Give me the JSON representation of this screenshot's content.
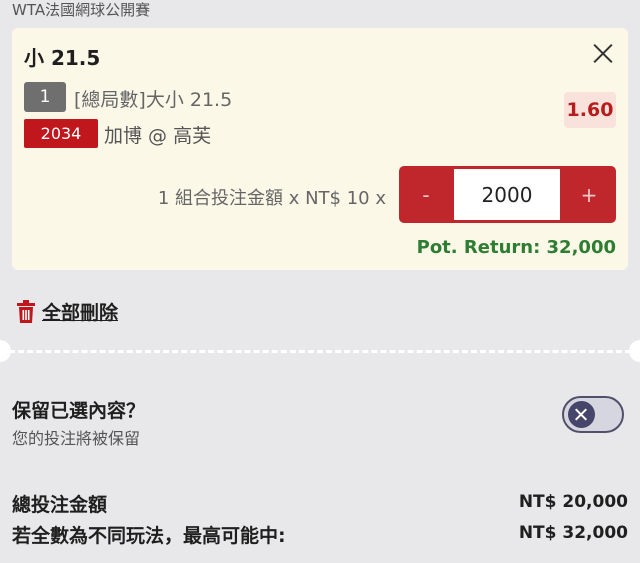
{
  "league": "WTA法國網球公開賽",
  "selection": {
    "title": "小 21.5",
    "leg_number": "1",
    "market": "[總局數]大小 21.5",
    "odds": "1.60",
    "event_id": "2034",
    "event": "加博 @ 高芙"
  },
  "stake": {
    "combo_label": "1 組合投注金額 x NT$ 10 x",
    "minus_label": "-",
    "plus_label": "+",
    "value": "2000",
    "pot_return": "Pot. Return: 32,000"
  },
  "actions": {
    "delete_all": "全部刪除"
  },
  "keep": {
    "title": "保留已選內容？",
    "subtitle": "您的投注將被保留",
    "toggle_on": false
  },
  "summary": {
    "total_label": "總投注金額",
    "total_value": "NT$ 20,000",
    "max_label": "若全數為不同玩法，最高可能中:",
    "max_value": "NT$ 32,000"
  },
  "colors": {
    "accent_red": "#c0272c",
    "odds_red": "#b71c1c",
    "return_green": "#2e7d32",
    "card_bg": "#fbf8e8"
  },
  "icons": [
    "close-icon",
    "trash-icon",
    "toggle-x-icon"
  ]
}
